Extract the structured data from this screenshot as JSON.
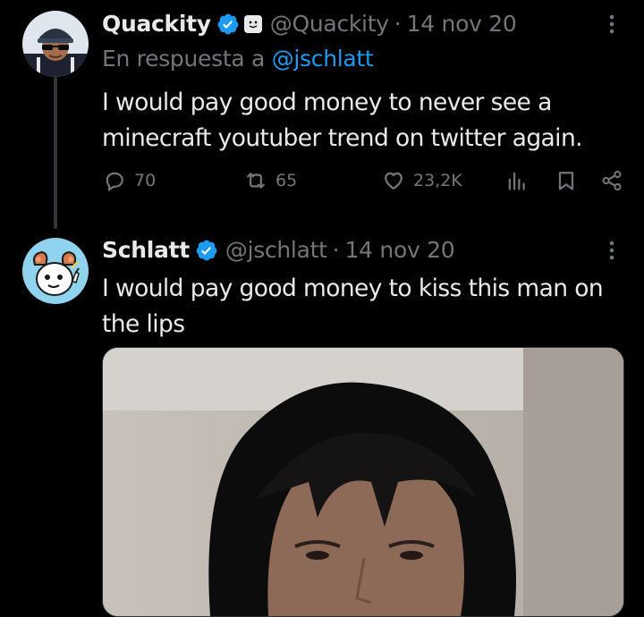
{
  "tweets": [
    {
      "author": {
        "name": "Quackity",
        "handle": "@Quackity"
      },
      "date": "14 nov 20",
      "separator": "·",
      "reply_prefix": "En respuesta a",
      "reply_to": "@jschlatt",
      "text": "I would pay good money to never see a minecraft youtuber trend on twitter again.",
      "stats": {
        "replies": "70",
        "retweets": "65",
        "likes": "23,2K"
      }
    },
    {
      "author": {
        "name": "Schlatt",
        "handle": "@jschlatt"
      },
      "date": "14 nov 20",
      "separator": "·",
      "text": "I would pay good money to kiss this man on the lips"
    }
  ],
  "colors": {
    "background": "#000000",
    "text_primary": "#e7e9ea",
    "text_secondary": "#71767b",
    "link": "#1d9bf0",
    "verified": "#1d9bf0",
    "thread_line": "#333639"
  },
  "icons": {
    "verified": "verified-badge-icon",
    "affiliate": "affiliate-badge-icon",
    "more": "more-options-icon",
    "reply": "reply-icon",
    "retweet": "retweet-icon",
    "like": "heart-icon",
    "views": "analytics-icon",
    "bookmark": "bookmark-icon",
    "share": "share-icon"
  }
}
